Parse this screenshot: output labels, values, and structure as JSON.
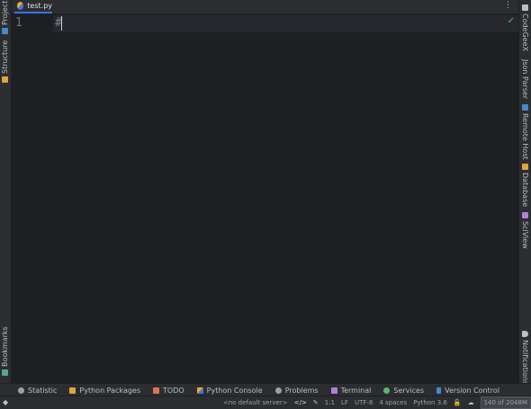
{
  "colors": {
    "accent": "#3574f0",
    "check": "#5fb865"
  },
  "left_strip": {
    "project": "Project",
    "structure": "Structure",
    "bookmarks": "Bookmarks"
  },
  "right_strip": {
    "codegeex": "CodeGeeX",
    "json_parser": "Json Parser",
    "remote_host": "Remote Host",
    "database": "Database",
    "sciview": "SciView",
    "notifications": "Notifications"
  },
  "editor": {
    "tab_label": "test.py",
    "line_numbers": [
      "1"
    ],
    "code_line": "#"
  },
  "tool_windows": [
    {
      "label": "Statistic",
      "icon": "statistic-icon"
    },
    {
      "label": "Python Packages",
      "icon": "python-packages-icon"
    },
    {
      "label": "TODO",
      "icon": "todo-icon"
    },
    {
      "label": "Python Console",
      "icon": "python-console-icon"
    },
    {
      "label": "Problems",
      "icon": "problems-icon"
    },
    {
      "label": "Terminal",
      "icon": "terminal-icon"
    },
    {
      "label": "Services",
      "icon": "services-icon"
    },
    {
      "label": "Version Control",
      "icon": "version-control-icon"
    }
  ],
  "status": {
    "server": "<no default server>",
    "position": "1:1",
    "line_separator": "LF",
    "encoding": "UTF-8",
    "indent": "4 spaces",
    "interpreter": "Python 3.6",
    "memory": "140 of 2048M"
  }
}
